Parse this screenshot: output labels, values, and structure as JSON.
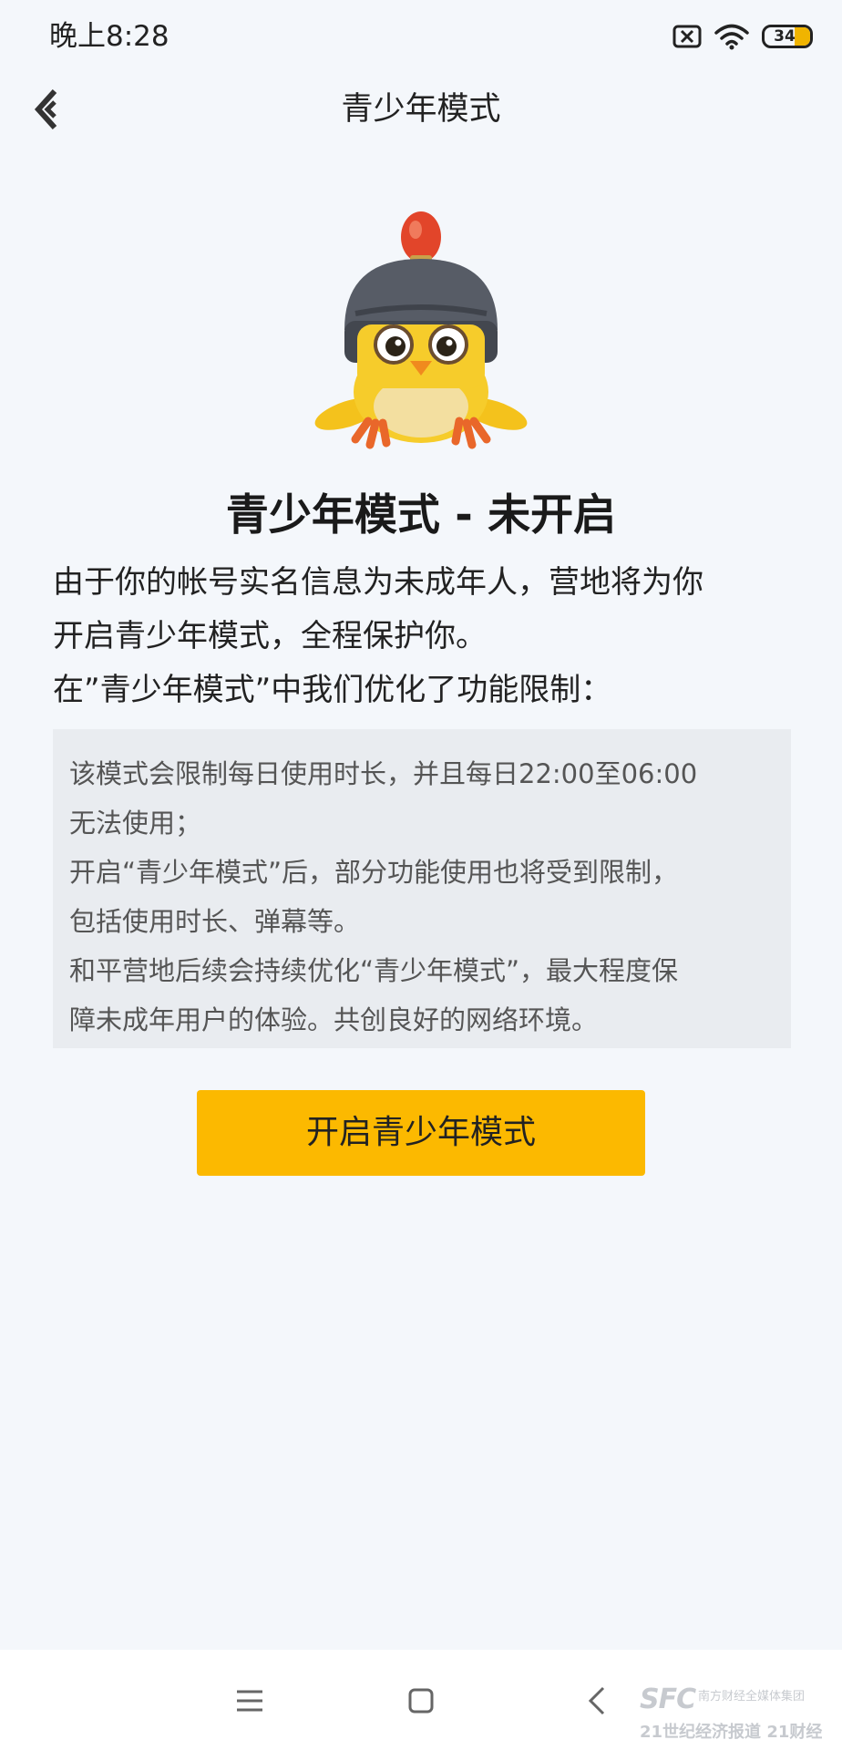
{
  "status_bar": {
    "time": "晚上8:28",
    "battery_level": "34",
    "battery_fill_fraction": 0.34,
    "icons": [
      "sim-disabled-icon",
      "wifi-icon",
      "battery-icon"
    ]
  },
  "header": {
    "title": "青少年模式",
    "back_icon": "chevron-left-icon"
  },
  "main": {
    "mascot": "helmet-chick-mascot",
    "status_title": "青少年模式 - 未开启",
    "intro_lines": [
      "由于你的帐号实名信息为未成年人，营地将为你",
      "开启青少年模式，全程保护你。",
      "在”青少年模式”中我们优化了功能限制："
    ],
    "info_lines": [
      "该模式会限制每日使用时长，并且每日22:00至06:00",
      "无法使用；",
      "开启“青少年模式”后，部分功能使用也将受到限制，",
      "包括使用时长、弹幕等。",
      "和平营地后续会持续优化“青少年模式”，最大程度保",
      "障未成年用户的体验。共创良好的网络环境。"
    ],
    "enable_button_label": "开启青少年模式"
  },
  "system_nav": {
    "icons": [
      "menu-icon",
      "home-icon",
      "back-icon"
    ]
  },
  "watermark": {
    "logo": "SFC",
    "line1": "南方财经全媒体集团",
    "line2": "21世纪经济报道 21财经"
  },
  "colors": {
    "page_background": "#f4f7fb",
    "button": "#fcb900",
    "info_box": "#e9ecf0",
    "battery_accent": "#f0b400"
  }
}
